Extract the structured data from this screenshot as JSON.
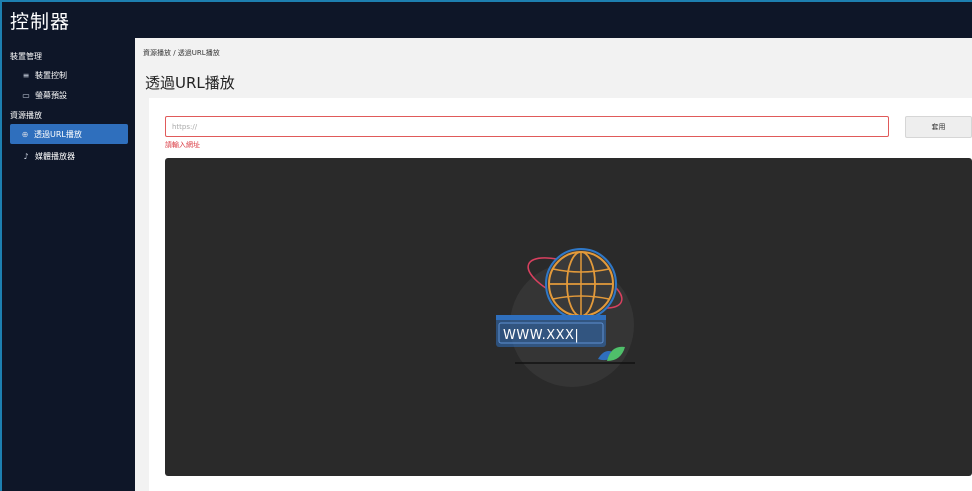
{
  "app": {
    "title": "控制器"
  },
  "sidebar": {
    "groups": [
      {
        "label": "裝置管理"
      },
      {
        "label": "資源播放"
      }
    ],
    "items": [
      {
        "label": "裝置控制",
        "icon": "list-icon"
      },
      {
        "label": "螢幕預設",
        "icon": "monitor-icon"
      },
      {
        "label": "透過URL播放",
        "icon": "globe-icon",
        "active": true
      },
      {
        "label": "媒體播放器",
        "icon": "media-icon"
      }
    ]
  },
  "main": {
    "breadcrumb": "資源播放 / 透過URL播放",
    "title": "透過URL播放",
    "url_input": {
      "placeholder": "https://",
      "value": ""
    },
    "error": "請輸入網址",
    "apply_label": "套用",
    "illustration_text": "WWW.XXX|"
  },
  "colors": {
    "background": "#0e1628",
    "accent": "#2f6fbd",
    "error": "#d9363e",
    "player": "#2a2a2a"
  }
}
